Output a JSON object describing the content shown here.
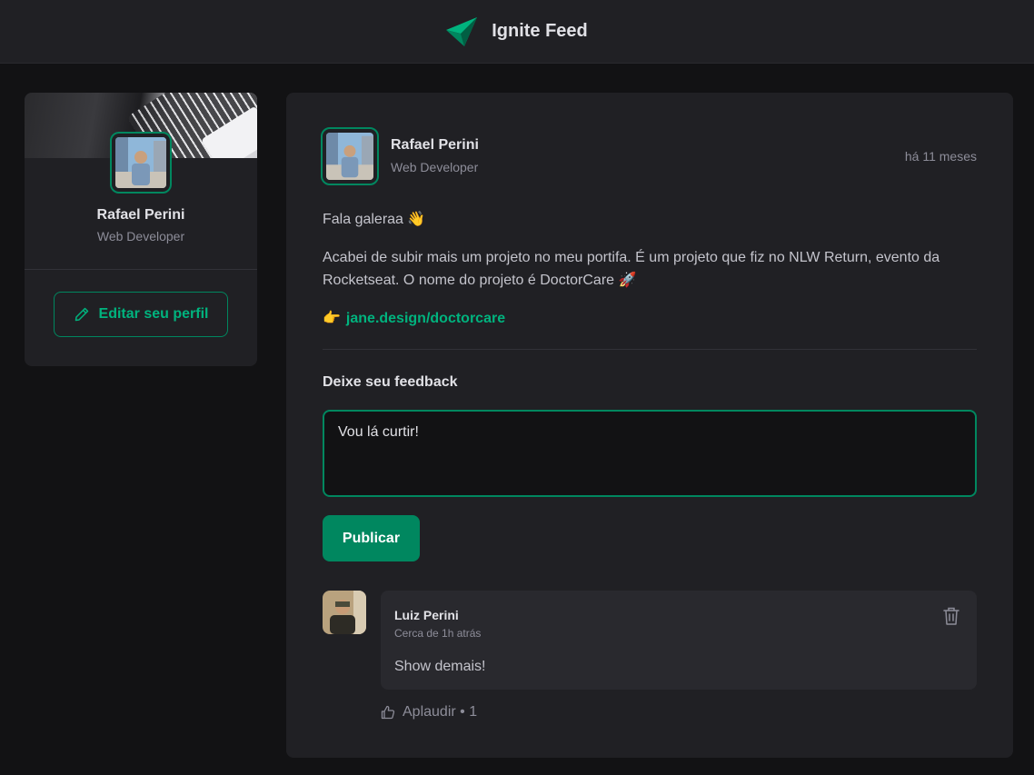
{
  "header": {
    "title": "Ignite Feed",
    "logo_icon": "paper-plane-icon"
  },
  "sidebar": {
    "name": "Rafael Perini",
    "role": "Web Developer",
    "edit_label": "Editar seu perfil",
    "edit_icon": "pencil-icon"
  },
  "post": {
    "author": "Rafael Perini",
    "role": "Web Developer",
    "time": "há 11 meses",
    "greeting": "Fala galeraa 👋",
    "body": "Acabei de subir mais um projeto no meu portifa. É um projeto que fiz no NLW Return, evento da Rocketseat. O nome do projeto é DoctorCare 🚀",
    "link_emoji": "👉",
    "link": "jane.design/doctorcare"
  },
  "feedback": {
    "title": "Deixe seu feedback",
    "value": "Vou lá curtir!",
    "publish_label": "Publicar"
  },
  "comment": {
    "author": "Luiz Perini",
    "time": "Cerca de 1h atrás",
    "text": "Show demais!",
    "applaud_label": "Aplaudir • 1"
  },
  "colors": {
    "accent": "#00875f",
    "accent_light": "#00b37e",
    "bg": "#121214",
    "card": "#202024"
  }
}
